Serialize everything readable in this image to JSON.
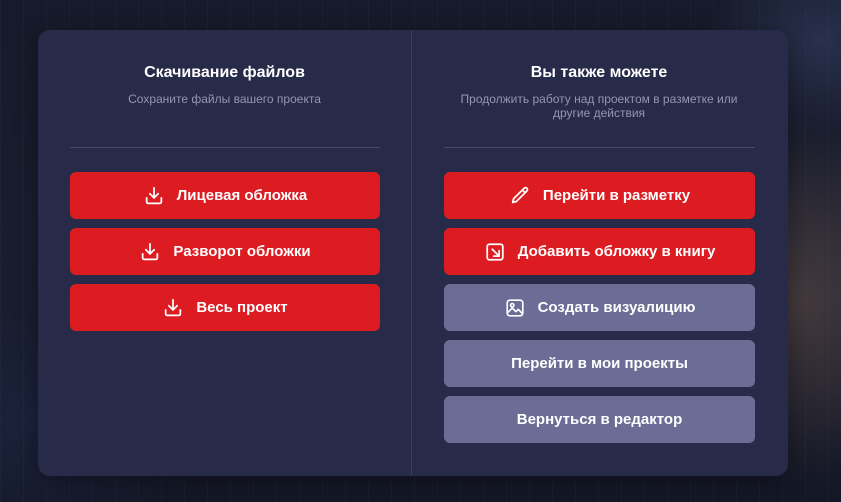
{
  "left": {
    "title": "Скачивание файлов",
    "subtitle": "Сохраните файлы вашего проекта",
    "buttons": [
      {
        "label": "Лицевая обложка",
        "icon": "download-icon"
      },
      {
        "label": "Разворот обложки",
        "icon": "download-icon"
      },
      {
        "label": "Весь проект",
        "icon": "download-icon"
      }
    ]
  },
  "right": {
    "title": "Вы также можете",
    "subtitle": "Продолжить работу над проектом в разметке или другие действия",
    "buttons": [
      {
        "label": "Перейти в разметку",
        "icon": "pencil-icon"
      },
      {
        "label": "Добавить обложку в книгу",
        "icon": "import-to-book-icon"
      },
      {
        "label": "Создать визуалицию",
        "icon": "image-icon"
      },
      {
        "label": "Перейти в мои проекты"
      },
      {
        "label": "Вернуться в редактор"
      }
    ]
  },
  "colors": {
    "card": "#272a48",
    "primary_button": "#dd1c22",
    "secondary_button": "#6b6d96",
    "text": "#ffffff",
    "muted_text": "#9497b0"
  }
}
